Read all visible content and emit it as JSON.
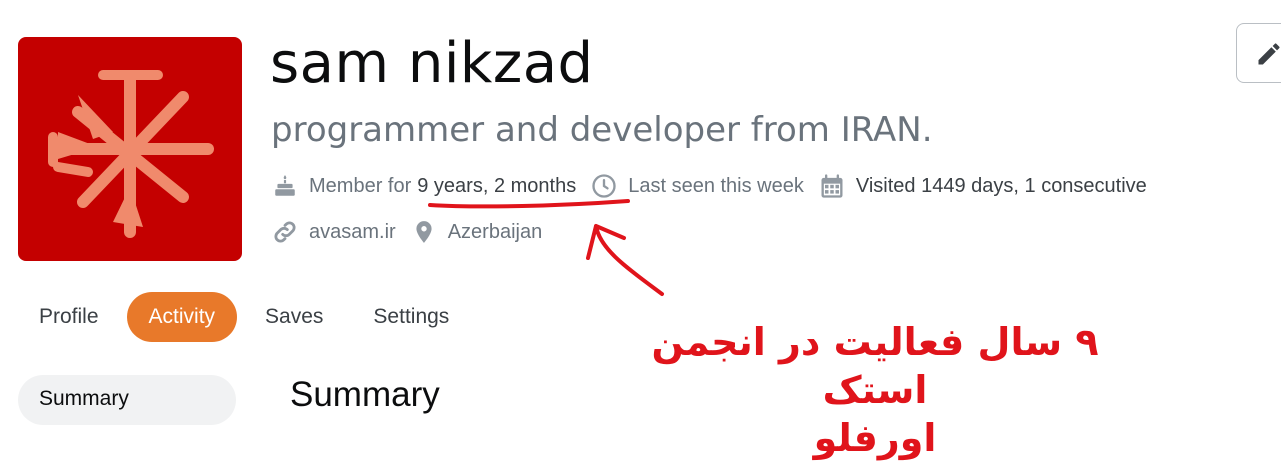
{
  "profile": {
    "name": "sam nikzad",
    "tagline": "programmer and developer from IRAN.",
    "member_prefix": "Member for",
    "member_duration": "9 years, 2 months",
    "last_seen": "Last seen this week",
    "visited": "Visited 1449 days, 1 consecutive",
    "website": "avasam.ir",
    "location": "Azerbaijan"
  },
  "tabs": [
    {
      "label": "Profile",
      "active": false
    },
    {
      "label": "Activity",
      "active": true
    },
    {
      "label": "Saves",
      "active": false
    },
    {
      "label": "Settings",
      "active": false
    }
  ],
  "sidebar": {
    "summary_label": "Summary"
  },
  "main": {
    "section_title": "Summary"
  },
  "annotation": {
    "line1": "۹ سال فعالیت در انجمن  استک",
    "line2": "اورفلو",
    "color": "#e0141b"
  },
  "colors": {
    "accent": "#e8792a",
    "avatar_bg": "#c40000",
    "avatar_fg": "#f08a6c"
  },
  "icons": {
    "member": "cake-icon",
    "last_seen": "clock-icon",
    "visited": "calendar-icon",
    "website": "link-icon",
    "location": "map-pin-icon",
    "edit": "pencil-icon"
  }
}
